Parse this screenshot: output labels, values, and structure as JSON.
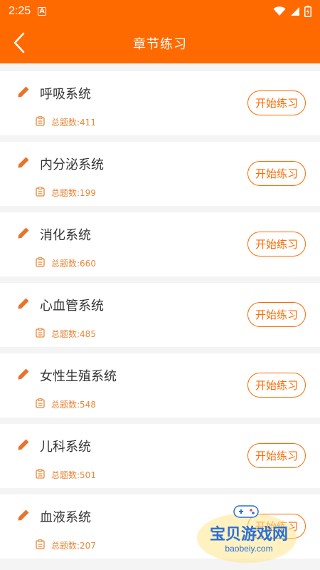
{
  "status_bar": {
    "time": "2:25",
    "icons": [
      "a-icon",
      "wifi-icon",
      "signal-icon",
      "battery-icon"
    ]
  },
  "header": {
    "title": "章节练习",
    "back_icon": "back-chevron-icon"
  },
  "colors": {
    "primary": "#ff6a00",
    "count_text": "#e8873a",
    "background": "#f4f4f4"
  },
  "chapters": [
    {
      "name": "呼吸系统",
      "count_label": "总题数:411",
      "button": "开始练习"
    },
    {
      "name": "内分泌系统",
      "count_label": "总题数:199",
      "button": "开始练习"
    },
    {
      "name": "消化系统",
      "count_label": "总题数:660",
      "button": "开始练习"
    },
    {
      "name": "心血管系统",
      "count_label": "总题数:485",
      "button": "开始练习"
    },
    {
      "name": "女性生殖系统",
      "count_label": "总题数:548",
      "button": "开始练习"
    },
    {
      "name": "儿科系统",
      "count_label": "总题数:501",
      "button": "开始练习"
    },
    {
      "name": "血液系统",
      "count_label": "总题数:207",
      "button": "开始练习"
    }
  ],
  "watermark": {
    "name": "宝贝游戏网",
    "url": "baobeiy.com"
  }
}
